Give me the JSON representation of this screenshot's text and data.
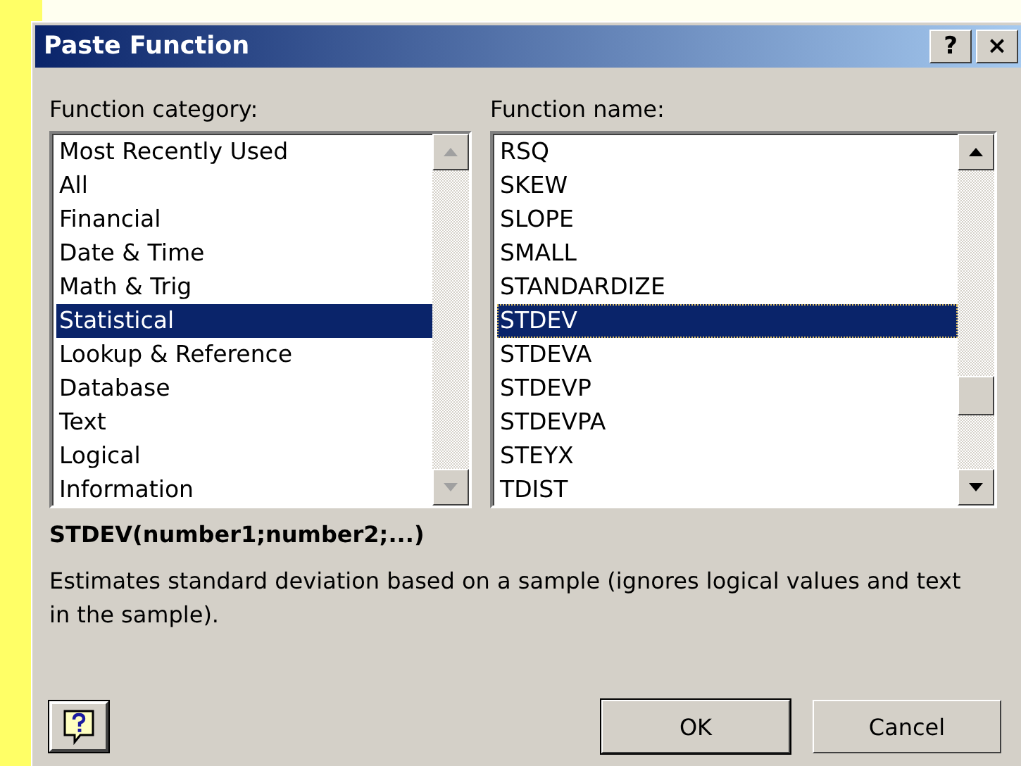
{
  "window": {
    "title": "Paste Function",
    "help_button": "?",
    "close_button": "×"
  },
  "category_list": {
    "label": "Function category:",
    "scroll_disabled": true,
    "items": [
      {
        "label": "Most Recently Used",
        "selected": false
      },
      {
        "label": "All",
        "selected": false
      },
      {
        "label": "Financial",
        "selected": false
      },
      {
        "label": "Date & Time",
        "selected": false
      },
      {
        "label": "Math & Trig",
        "selected": false
      },
      {
        "label": "Statistical",
        "selected": true
      },
      {
        "label": "Lookup & Reference",
        "selected": false
      },
      {
        "label": "Database",
        "selected": false
      },
      {
        "label": "Text",
        "selected": false
      },
      {
        "label": "Logical",
        "selected": false
      },
      {
        "label": "Information",
        "selected": false
      }
    ]
  },
  "name_list": {
    "label": "Function name:",
    "scroll_disabled": false,
    "items": [
      {
        "label": "RSQ",
        "selected": false
      },
      {
        "label": "SKEW",
        "selected": false
      },
      {
        "label": "SLOPE",
        "selected": false
      },
      {
        "label": "SMALL",
        "selected": false
      },
      {
        "label": "STANDARDIZE",
        "selected": false
      },
      {
        "label": "STDEV",
        "selected": true
      },
      {
        "label": "STDEVA",
        "selected": false
      },
      {
        "label": "STDEVP",
        "selected": false
      },
      {
        "label": "STDEVPA",
        "selected": false
      },
      {
        "label": "STEYX",
        "selected": false
      },
      {
        "label": "TDIST",
        "selected": false
      }
    ]
  },
  "syntax": "STDEV(number1;number2;...)",
  "description": "Estimates standard deviation based on a sample (ignores logical values and text in the sample).",
  "buttons": [
    "OK",
    "Cancel"
  ]
}
